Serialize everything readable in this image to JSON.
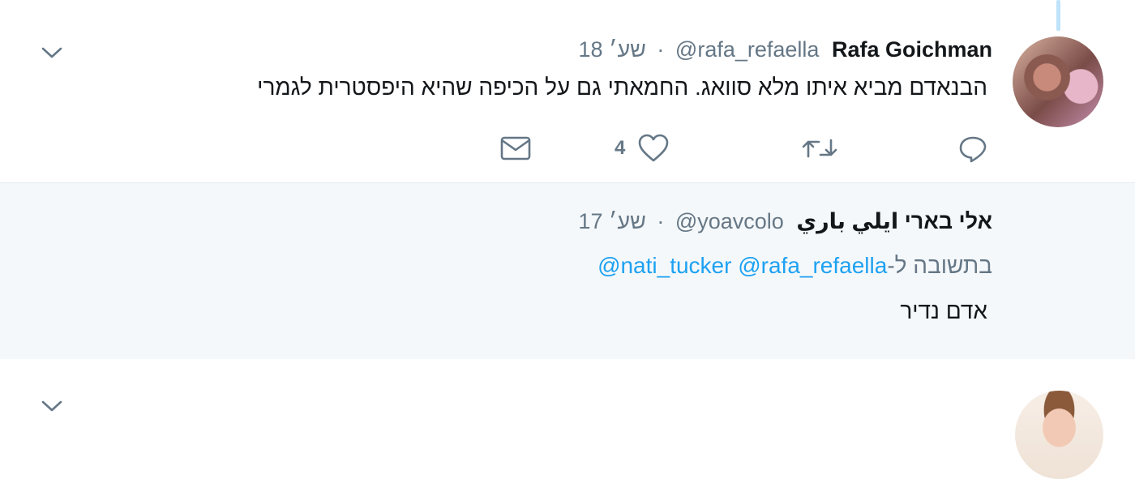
{
  "tweets": [
    {
      "name": "Rafa Goichman",
      "handle": "@rafa_refaella",
      "separator": "·",
      "time": "18 שע׳",
      "text": "הבנאדם מביא איתו מלא סוואג. החמאתי גם על הכיפה שהיא היפסטרית לגמרי",
      "actions": {
        "like_count": "4"
      }
    },
    {
      "name": "אלי בארי ايلي باري",
      "handle": "@yoavcolo",
      "separator": "·",
      "time": "17 שע׳",
      "reply_prefix": "בתשובה ל-",
      "mentions": [
        "@rafa_refaella",
        "@nati_tucker"
      ],
      "text": "אדם נדיר"
    }
  ],
  "icons": {
    "chevron": "chevron-down-icon",
    "reply": "reply-icon",
    "retweet": "retweet-icon",
    "like": "heart-icon",
    "dm": "direct-message-icon"
  },
  "colors": {
    "link": "#1da1f2",
    "muted": "#657786",
    "text": "#14171a",
    "reply_bg": "#f5f8fa"
  }
}
